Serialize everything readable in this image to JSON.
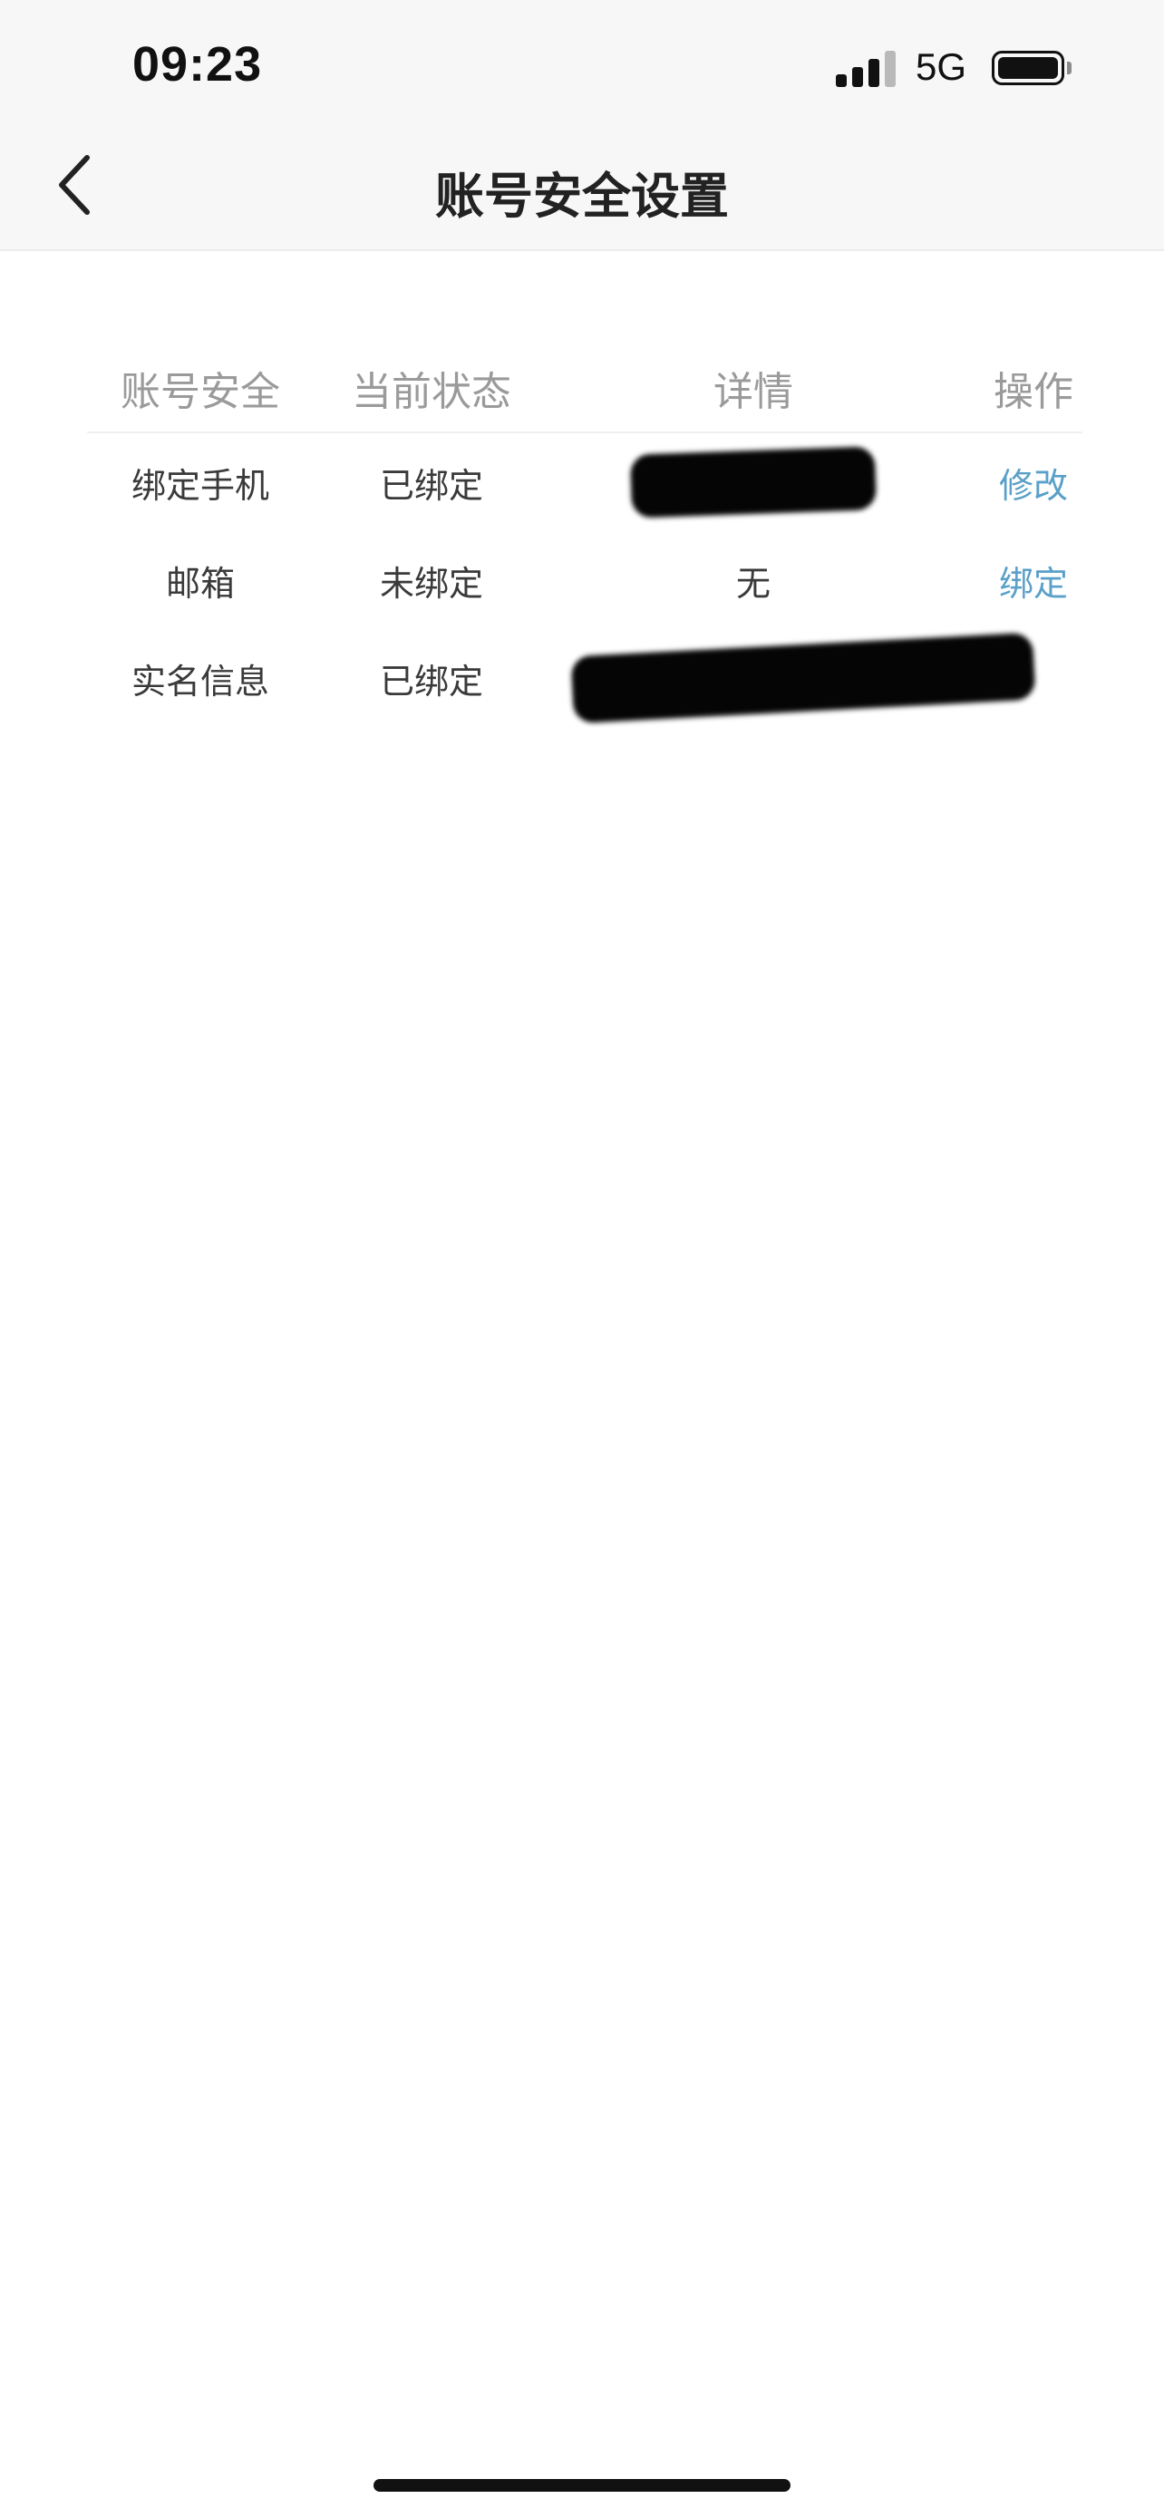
{
  "status_bar": {
    "time": "09:23",
    "network": "5G",
    "signal_bars_active": 3,
    "signal_bars_total": 4
  },
  "nav": {
    "back_icon": "chevron-left-icon",
    "title": "账号安全设置"
  },
  "table": {
    "headers": [
      "账号安全",
      "当前状态",
      "详情",
      "操作"
    ],
    "rows": [
      {
        "item": "绑定手机",
        "status": "已绑定",
        "detail": "",
        "detail_redacted": true,
        "action": "修改"
      },
      {
        "item": "邮箱",
        "status": "未绑定",
        "detail": "无",
        "detail_redacted": false,
        "action": "绑定"
      },
      {
        "item": "实名信息",
        "status": "已绑定",
        "detail": "",
        "detail_redacted": true,
        "action": ""
      }
    ]
  },
  "colors": {
    "action_link": "#5aa0c8",
    "header_text": "#9a9a9a",
    "redaction": "#050505"
  }
}
